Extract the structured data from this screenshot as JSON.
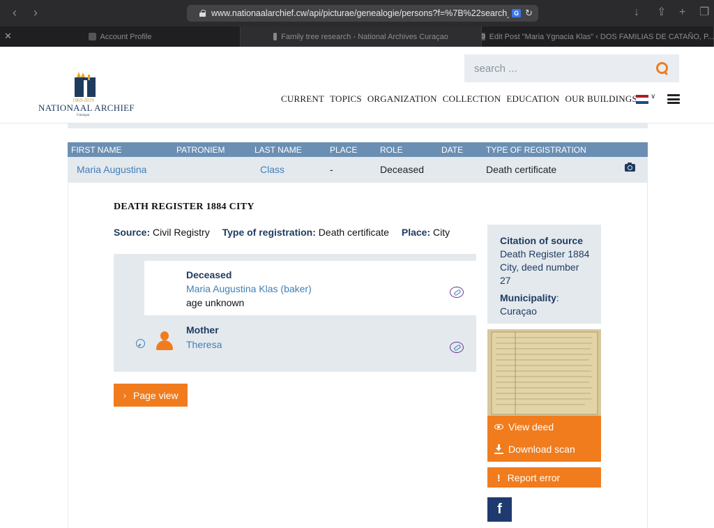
{
  "browser": {
    "url": "www.nationaalarchief.cw/api/picturae/genealogie/persons?f=%7B%22search_s_",
    "translate_badge": "G",
    "tabs": [
      {
        "label": "Account Profile",
        "icon": "id-card-icon"
      },
      {
        "label": "Family tree research - National Archives Curaçao",
        "icon": "key-icon"
      },
      {
        "label": "Edit Post \"Maria Ygnacia Klas\" ‹ DOS FAMILIAS DE CATAÑO, P...",
        "icon": "d-logo-icon"
      }
    ]
  },
  "header": {
    "logo_years": "1969-2019",
    "logo_name": "NATIONAAL ARCHIEF",
    "logo_sub": "Curaçao",
    "search_placeholder": "search ...",
    "nav": [
      "CURRENT",
      "TOPICS",
      "ORGANIZATION",
      "COLLECTION",
      "EDUCATION",
      "OUR BUILDINGS"
    ],
    "flag_colors": [
      "#ae1c28",
      "#ffffff",
      "#21468b"
    ]
  },
  "results": {
    "columns": [
      "FIRST NAME",
      "PATRONIEM",
      "LAST NAME",
      "PLACE",
      "ROLE",
      "DATE",
      "TYPE OF REGISTRATION"
    ],
    "row": {
      "first_name": "Maria Augustina",
      "patroniem": "",
      "last_name": "Class",
      "place": "-",
      "role": "Deceased",
      "date": "",
      "type": "Death certificate"
    }
  },
  "detail": {
    "title": "DEATH REGISTER 1884 CITY",
    "source_label": "Source:",
    "source_value": "Civil Registry",
    "type_label": "Type of registration:",
    "type_value": "Death certificate",
    "place_label": "Place:",
    "place_value": "City",
    "persons": [
      {
        "role": "Deceased",
        "name": "Maria Augustina Klas (baker)",
        "extra": "age unknown"
      },
      {
        "role": "Mother",
        "name": "Theresa",
        "extra": ""
      }
    ],
    "page_view_label": "Page view"
  },
  "sidebar": {
    "citation_label": "Citation of source",
    "citation_line1": "Death Register 1884",
    "citation_line2": "City, deed number",
    "citation_line3": "27",
    "municipality_label": "Municipality",
    "municipality_colon": ":",
    "municipality_value": "Curaçao",
    "view_deed_label": "View deed",
    "download_scan_label": "Download scan",
    "report_error_label": "Report error",
    "facebook_label": "f"
  },
  "colors": {
    "accent_orange": "#f07c1e",
    "header_blue": "#6b8fb3",
    "navy": "#1e3a5f",
    "link_blue": "#3f7fb8",
    "panel_grey": "#e4e9ee"
  }
}
